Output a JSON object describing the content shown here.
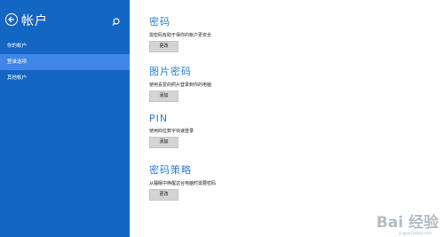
{
  "sidebar": {
    "title": "帐户",
    "items": [
      {
        "label": "你的帐户"
      },
      {
        "label": "登录选项"
      },
      {
        "label": "其他帐户"
      }
    ]
  },
  "sections": [
    {
      "title": "密码",
      "description": "需密码有助于保你的帐户更安全",
      "button": "更改"
    },
    {
      "title": "图片密码",
      "description": "使用喜爱的照片登录到你的电脑",
      "button": "添加"
    },
    {
      "title": "PIN",
      "description": "使用四位数字快速登录",
      "button": "添加"
    },
    {
      "title": "密码策略",
      "description": "从睡眠中唤醒这台电脑时需要密码",
      "button": "更改"
    }
  ],
  "watermark": {
    "text": "Bai 经验",
    "sub": "jingyan.baidu.com"
  },
  "colors": {
    "sidebar": "#1466c4",
    "active_item": "#3f86e6",
    "section_title": "#2f7fd6"
  }
}
